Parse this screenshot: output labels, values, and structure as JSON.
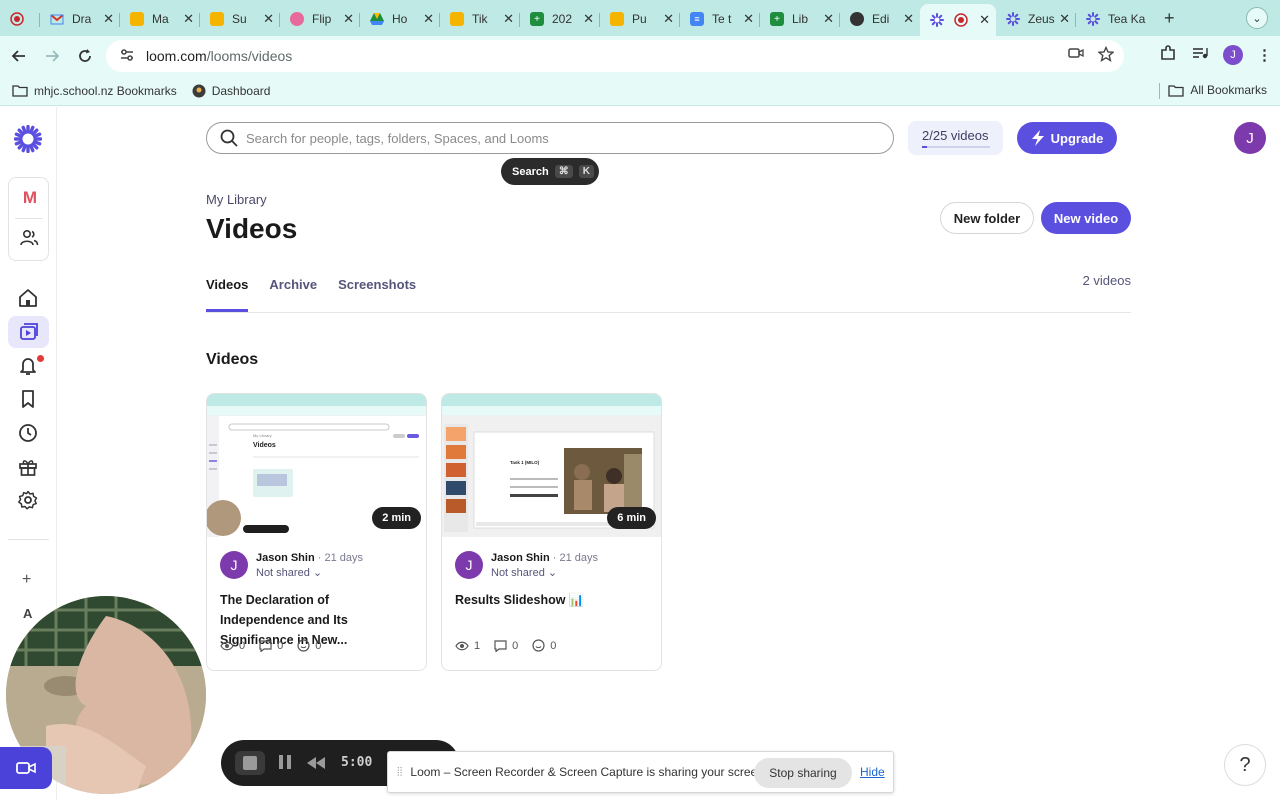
{
  "browser": {
    "tabs": [
      {
        "title": "",
        "icon": "recording-dot-icon",
        "color": "#c9252d"
      },
      {
        "title": "Dra",
        "icon": "gmail-icon",
        "color": "#d93025"
      },
      {
        "title": "Ma",
        "icon": "slides-icon",
        "color": "#f4b400"
      },
      {
        "title": "Su",
        "icon": "slides-icon",
        "color": "#f4b400"
      },
      {
        "title": "Flip",
        "icon": "flip-icon",
        "color": "#e86a9a"
      },
      {
        "title": "Ho",
        "icon": "drive-icon",
        "color": "#1e8e3e"
      },
      {
        "title": "Tik",
        "icon": "slides-icon",
        "color": "#f4b400"
      },
      {
        "title": "202",
        "icon": "sheets-icon",
        "color": "#1e8e3e"
      },
      {
        "title": "Pu",
        "icon": "slides-icon",
        "color": "#f4b400"
      },
      {
        "title": "Te t",
        "icon": "docs-icon",
        "color": "#4285f4"
      },
      {
        "title": "Lib",
        "icon": "sheets-icon",
        "color": "#1e8e3e"
      },
      {
        "title": "Edi",
        "icon": "globe-icon",
        "color": "#333333"
      },
      {
        "title": "",
        "icon": "loom-icon",
        "color": "#5b4fe0"
      },
      {
        "title": "Zeus a",
        "icon": "loom-icon",
        "color": "#5b4fe0"
      },
      {
        "title": "Tea Ka",
        "icon": "loom-icon",
        "color": "#5b4fe0"
      }
    ],
    "active_tab_index": 12,
    "url_host": "loom.com",
    "url_path": "/looms/videos",
    "bookmarks": [
      {
        "label": "mhjc.school.nz Bookmarks",
        "icon": "folder-icon"
      },
      {
        "label": "Dashboard",
        "icon": "dashboard-icon"
      }
    ],
    "all_bookmarks_label": "All Bookmarks",
    "profile_initial": "J"
  },
  "loom": {
    "workspace_initial": "M",
    "search_placeholder": "Search for people, tags, folders, Spaces, and Looms",
    "search_tip": {
      "label": "Search",
      "key1": "⌘",
      "key2": "K"
    },
    "quota": {
      "label": "2/25 videos",
      "used": 2,
      "limit": 25
    },
    "upgrade_label": "Upgrade",
    "user_initial": "J",
    "breadcrumb": "My Library",
    "page_title": "Videos",
    "new_folder_label": "New folder",
    "new_video_label": "New video",
    "tabs": [
      "Videos",
      "Archive",
      "Screenshots"
    ],
    "active_tab": "Videos",
    "video_count": "2 videos",
    "section_title": "Videos",
    "side_extra_initial": "A",
    "videos": [
      {
        "duration": "2 min",
        "author": "Jason Shin",
        "age": "21 days",
        "sharing": "Not shared",
        "title": "The Declaration of Independence and Its Significance in New...",
        "views": "0",
        "comments": "0",
        "reactions": "0",
        "avatar_initial": "J"
      },
      {
        "duration": "6 min",
        "author": "Jason Shin",
        "age": "21 days",
        "sharing": "Not shared",
        "title": "Results Slideshow 📊",
        "views": "1",
        "comments": "0",
        "reactions": "0",
        "avatar_initial": "J",
        "thumb_caption": "Task 1 (MILO)"
      }
    ]
  },
  "recorder": {
    "time": "5:00"
  },
  "share_notice": {
    "text": "Loom – Screen Recorder & Screen Capture is sharing your screen.",
    "stop_label": "Stop sharing",
    "hide_label": "Hide"
  },
  "help_label": "?"
}
